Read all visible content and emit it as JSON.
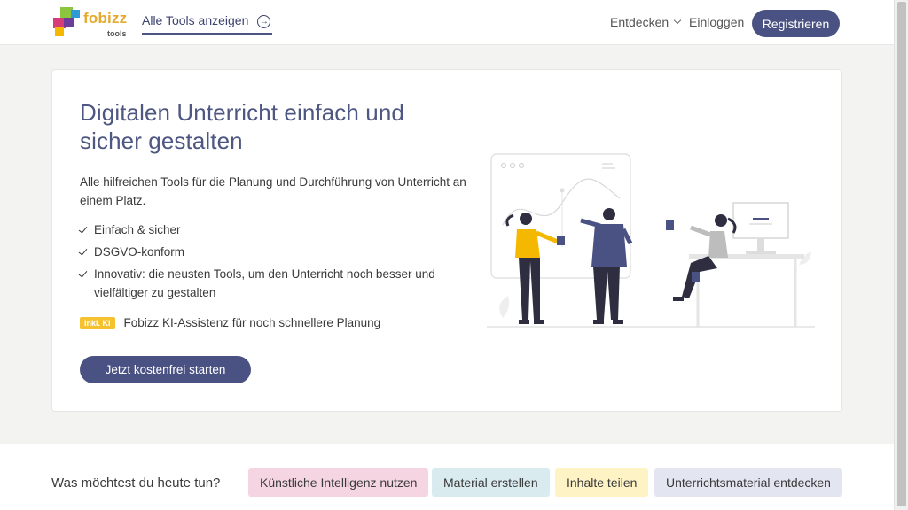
{
  "header": {
    "logo_text": "fobizz",
    "logo_sub": "tools",
    "all_tools_label": "Alle Tools anzeigen",
    "nav_explore": "Entdecken",
    "nav_login": "Einloggen",
    "register_label": "Registrieren"
  },
  "hero": {
    "title": "Digitalen Unterricht einfach und sicher gestalten",
    "description": "Alle hilfreichen Tools für die Planung und Durchführung von Unterricht an einem Platz.",
    "features": [
      "Einfach & sicher",
      "DSGVO-konform",
      "Innovativ: die neusten Tools, um den Unterricht noch besser und vielfältiger zu gestalten"
    ],
    "ki_badge": "Inkl. KI",
    "ki_text": "Fobizz KI-Assistenz für noch schnellere Planung",
    "cta_label": "Jetzt kostenfrei starten"
  },
  "bottom": {
    "question": "Was möchtest du heute tun?",
    "chips": [
      "Künstliche Intelligenz nutzen",
      "Material erstellen",
      "Inhalte teilen",
      "Unterrichtsmaterial entdecken"
    ]
  },
  "colors": {
    "brand_primary": "#4a5283",
    "logo_yellow": "#e5a92b",
    "badge_yellow": "#f5c12e",
    "chip_pink": "#f5d5e1",
    "chip_blue": "#d9ebef",
    "chip_yellow": "#fdf3c5",
    "chip_lavender": "#e3e6f1"
  }
}
